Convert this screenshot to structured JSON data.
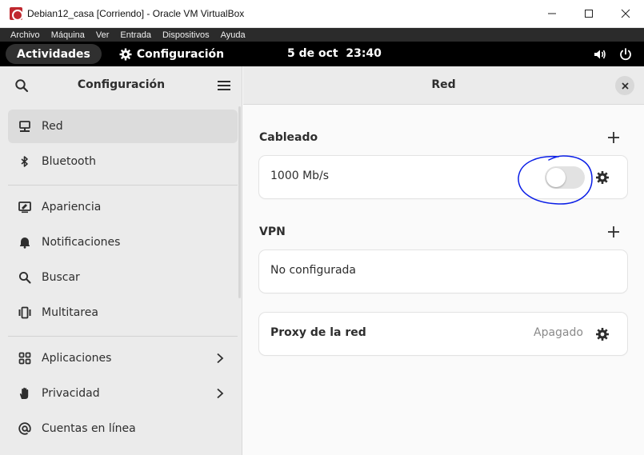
{
  "host_window": {
    "title": "Debian12_casa [Corriendo] - Oracle VM VirtualBox",
    "menu": [
      "Archivo",
      "Máquina",
      "Ver",
      "Entrada",
      "Dispositivos",
      "Ayuda"
    ]
  },
  "topbar": {
    "activities": "Actividades",
    "app_name": "Configuración",
    "clock": "5 de oct  23:40"
  },
  "sidebar": {
    "title": "Configuración",
    "items": [
      {
        "label": "Red",
        "icon": "network-wired-icon",
        "selected": true
      },
      {
        "label": "Bluetooth",
        "icon": "bluetooth-icon"
      },
      {
        "label": "Apariencia",
        "icon": "appearance-icon"
      },
      {
        "label": "Notificaciones",
        "icon": "bell-icon"
      },
      {
        "label": "Buscar",
        "icon": "search-icon"
      },
      {
        "label": "Multitarea",
        "icon": "multitasking-icon"
      },
      {
        "label": "Aplicaciones",
        "icon": "apps-grid-icon",
        "has_submenu": true
      },
      {
        "label": "Privacidad",
        "icon": "hand-icon",
        "has_submenu": true
      },
      {
        "label": "Cuentas en línea",
        "icon": "at-sign-icon"
      }
    ]
  },
  "content": {
    "title": "Red",
    "wired": {
      "heading": "Cableado",
      "connection_label": "1000 Mb/s",
      "toggle_on": false
    },
    "vpn": {
      "heading": "VPN",
      "empty_label": "No configurada"
    },
    "proxy": {
      "label": "Proxy de la red",
      "status": "Apagado"
    }
  },
  "colors": {
    "annotation": "#0a1ee6",
    "sidebar_bg": "#ebebeb",
    "selected_bg": "#dcdcdc"
  }
}
